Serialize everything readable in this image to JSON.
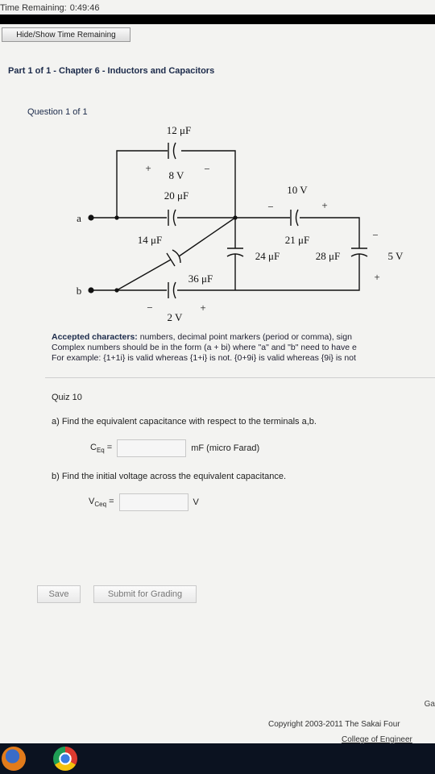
{
  "timer": {
    "label": "Time Remaining:",
    "value": "0:49:46"
  },
  "hide_button": {
    "label": "Hide/Show Time Remaining"
  },
  "part": {
    "prefix": "Part",
    "number": "1 of 1",
    "sep": "-",
    "chapter": "Chapter 6",
    "dash": "-",
    "title": "Inductors and Capacitors"
  },
  "question": {
    "label": "Question 1 of 1"
  },
  "circuit": {
    "c_top": "12 μF",
    "v_top": "8 V",
    "top_plus": "+",
    "top_minus": "−",
    "c_mid": "20 μF",
    "c_10v_label": "10 V",
    "p10_minus": "−",
    "p10_plus": "+",
    "c_diag": "14 μF",
    "c_21": "21 μF",
    "c_24": "24 μF",
    "c_28": "28 μF",
    "v_5": "5 V",
    "v5_plus": "+",
    "v5_minus": "−",
    "c_36": "36 μF",
    "v_2": "2 V",
    "v2_minus": "−",
    "v2_plus": "+",
    "term_a": "a",
    "term_b": "b"
  },
  "accepted": {
    "bold": "Accepted characters:",
    "line1": " numbers, decimal point markers (period or comma), sign",
    "line2": "Complex numbers should be in the form (a + bi) where \"a\" and \"b\" need to have e",
    "line3": "For example: {1+1i} is valid whereas {1+i} is not. {0+9i} is valid whereas {9i} is not"
  },
  "quiz": {
    "title": "Quiz 10",
    "part_a": "a) Find the equivalent capacitance with respect to the terminals a,b.",
    "ceq_label_main": "C",
    "ceq_label_sub": "Eq",
    "ceq_eq": " =",
    "ceq_value": "",
    "ceq_unit": "mF  (micro Farad)",
    "part_b": "b) Find the initial voltage across the equivalent capacitance.",
    "vceq_label_main": "V",
    "vceq_label_sub": "Ceq",
    "vceq_eq": " =",
    "vceq_value": "",
    "vceq_unit": "V"
  },
  "buttons": {
    "save": "Save",
    "submit": "Submit for Grading"
  },
  "footer": {
    "right_fragment": "Ga",
    "copyright": "Copyright 2003-2011 The Sakai Four",
    "college": "College of Engineer"
  },
  "taskbar": {
    "icons": [
      "firefox-icon",
      "chrome-icon"
    ]
  }
}
